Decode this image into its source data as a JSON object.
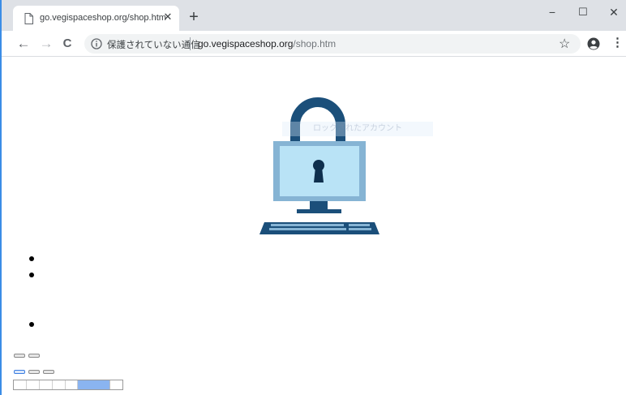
{
  "browser": {
    "tab": {
      "title": "go.vegispaceshop.org/shop.htm",
      "close_glyph": "✕",
      "icon": "page-icon"
    },
    "new_tab_glyph": "+",
    "window_controls": {
      "minimize": "−",
      "maximize": "☐",
      "close": "✕"
    },
    "toolbar": {
      "back_glyph": "←",
      "forward_glyph": "→",
      "reload_glyph": "C",
      "security_text": "保護されていない通信",
      "url_host": "go.vegispaceshop.org",
      "url_path": "/shop.htm",
      "star_glyph": "☆",
      "menu_glyph": "⋮"
    }
  },
  "page": {
    "illustration": "computer-padlock-icon",
    "overlay_text": "ロックされたアカウント",
    "bullet_count": 3
  },
  "colors": {
    "tabstrip_bg": "#dee1e6",
    "lock_dark": "#1b4f7a",
    "screen_light": "#b9e3f6",
    "monitor_frame": "#86b4d4",
    "table_highlight": "#8ab4f0",
    "accent": "#3b8de6"
  }
}
